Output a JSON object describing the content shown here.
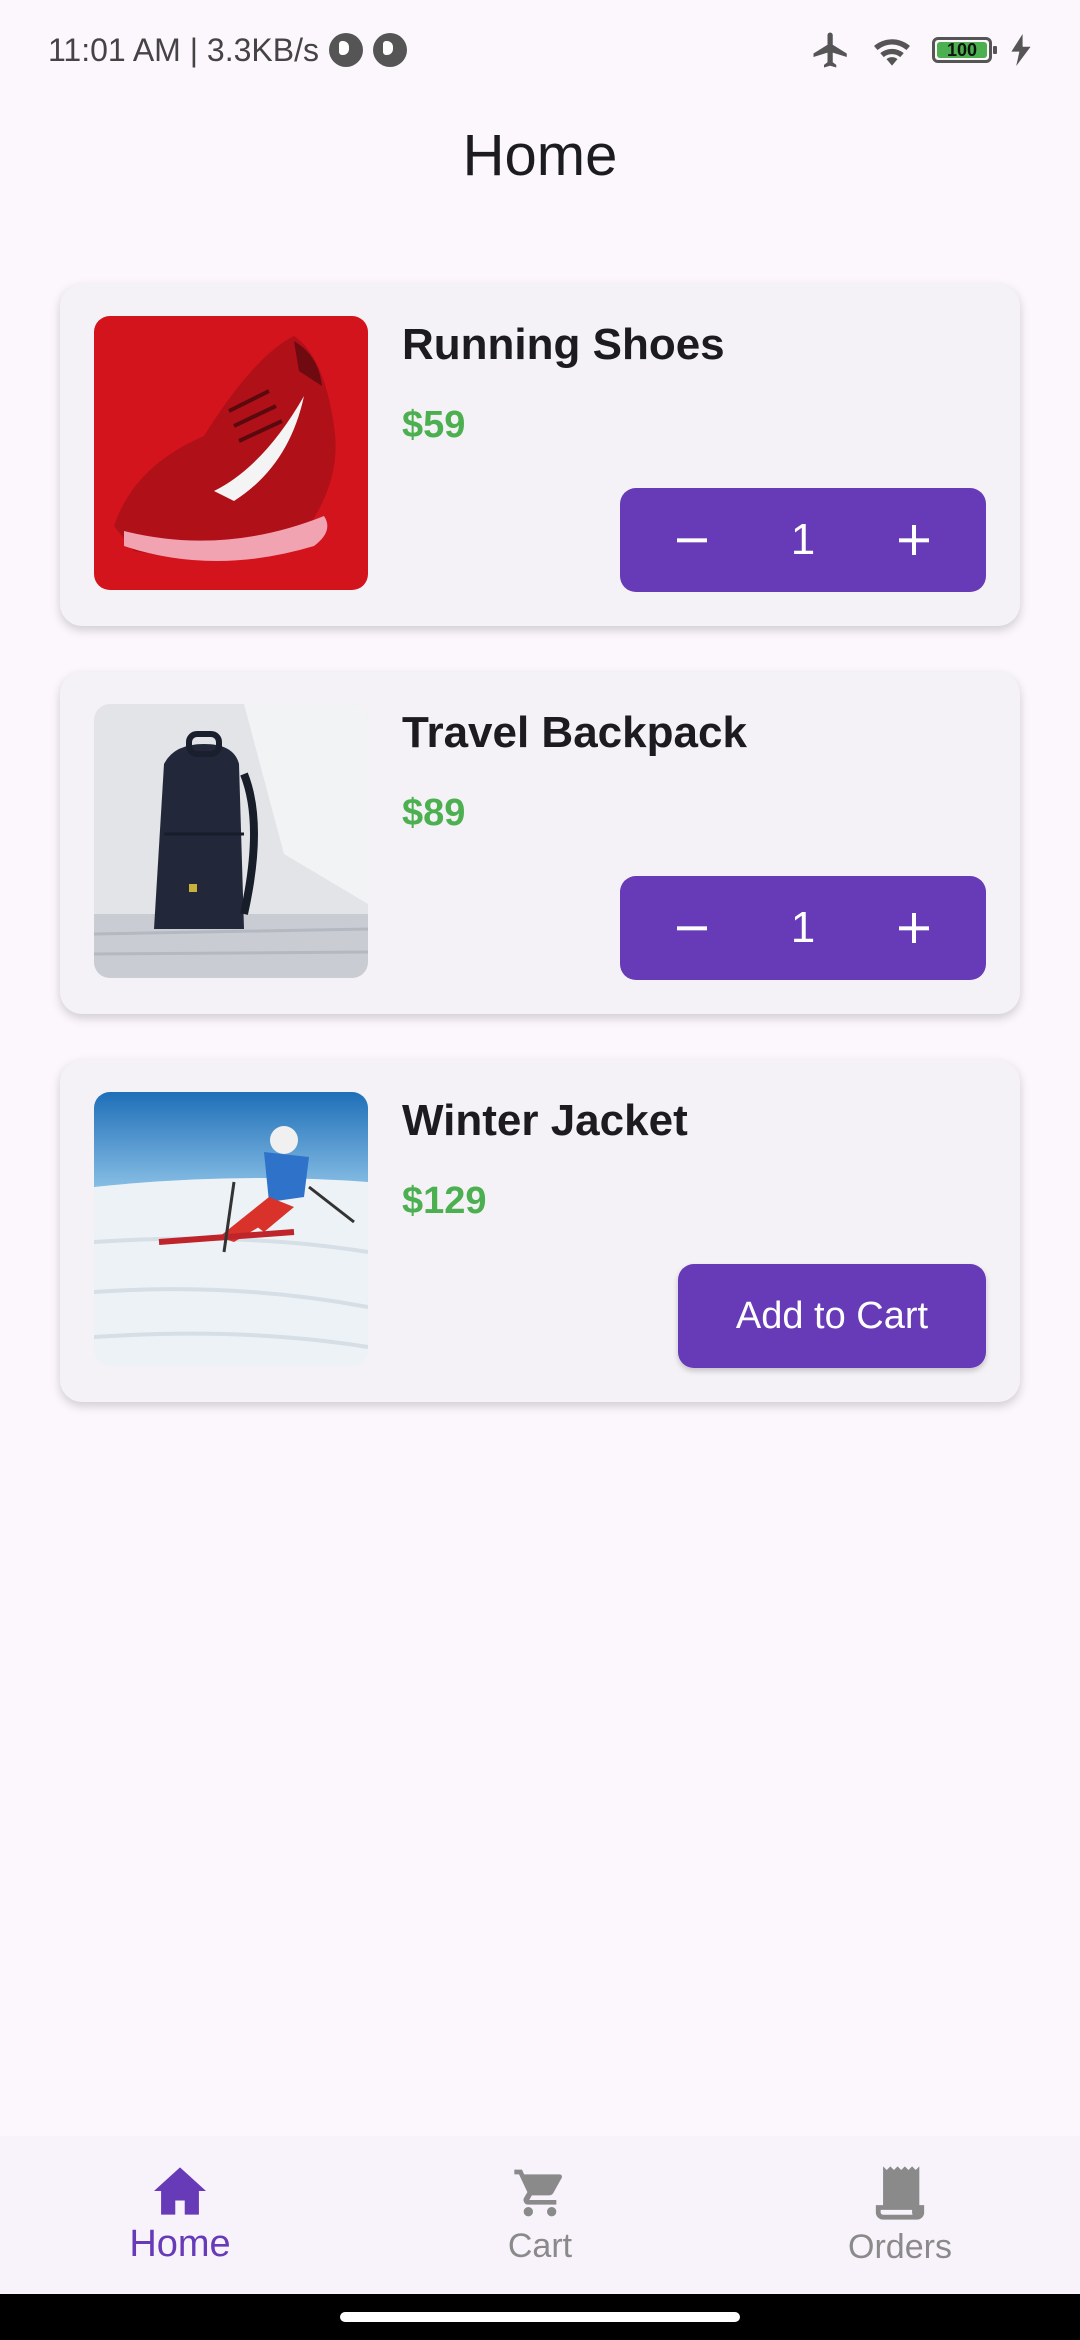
{
  "status_bar": {
    "time_speed": "11:01 AM | 3.3KB/s",
    "battery_level": "100",
    "icons": [
      "notification-p-icon",
      "notification-p-icon",
      "airplane-icon",
      "wifi-icon",
      "battery-icon",
      "charging-bolt-icon"
    ]
  },
  "app_bar": {
    "title": "Home"
  },
  "products": [
    {
      "name": "Running Shoes",
      "price": "$59",
      "image": "red-running-shoe-image",
      "quantity": "1",
      "in_cart": true
    },
    {
      "name": "Travel Backpack",
      "price": "$89",
      "image": "navy-backpack-image",
      "quantity": "1",
      "in_cart": true
    },
    {
      "name": "Winter Jacket",
      "price": "$129",
      "image": "skier-jacket-image",
      "action_label": "Add to Cart",
      "in_cart": false
    }
  ],
  "bottom_nav": {
    "items": [
      {
        "label": "Home",
        "icon": "home-icon",
        "active": true
      },
      {
        "label": "Cart",
        "icon": "cart-icon",
        "active": false
      },
      {
        "label": "Orders",
        "icon": "receipt-icon",
        "active": false
      }
    ]
  },
  "colors": {
    "accent": "#673AB7",
    "price": "#4CAF50",
    "background": "#FCF7FD",
    "card": "#F4F2F6",
    "inactive_nav": "#8A8A8A"
  }
}
